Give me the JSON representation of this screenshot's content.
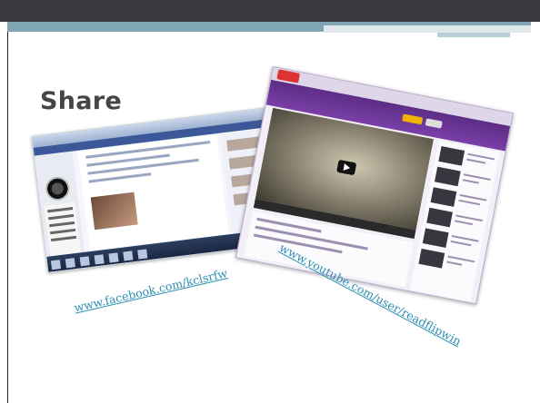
{
  "slide": {
    "title": "Share",
    "colors": {
      "top_bar": "#3a3a3f",
      "accent_band": "#7fa5b2",
      "title_text": "#454545",
      "link": "#2d8fb1"
    }
  },
  "links": {
    "facebook": "www.facebook.com/kclsrfw",
    "youtube": "www.youtube.com/user/readflipwin"
  },
  "images": {
    "facebook_screenshot": {
      "semantic": "facebook-page-screenshot-icon"
    },
    "youtube_screenshot": {
      "semantic": "youtube-channel-screenshot-icon"
    }
  }
}
